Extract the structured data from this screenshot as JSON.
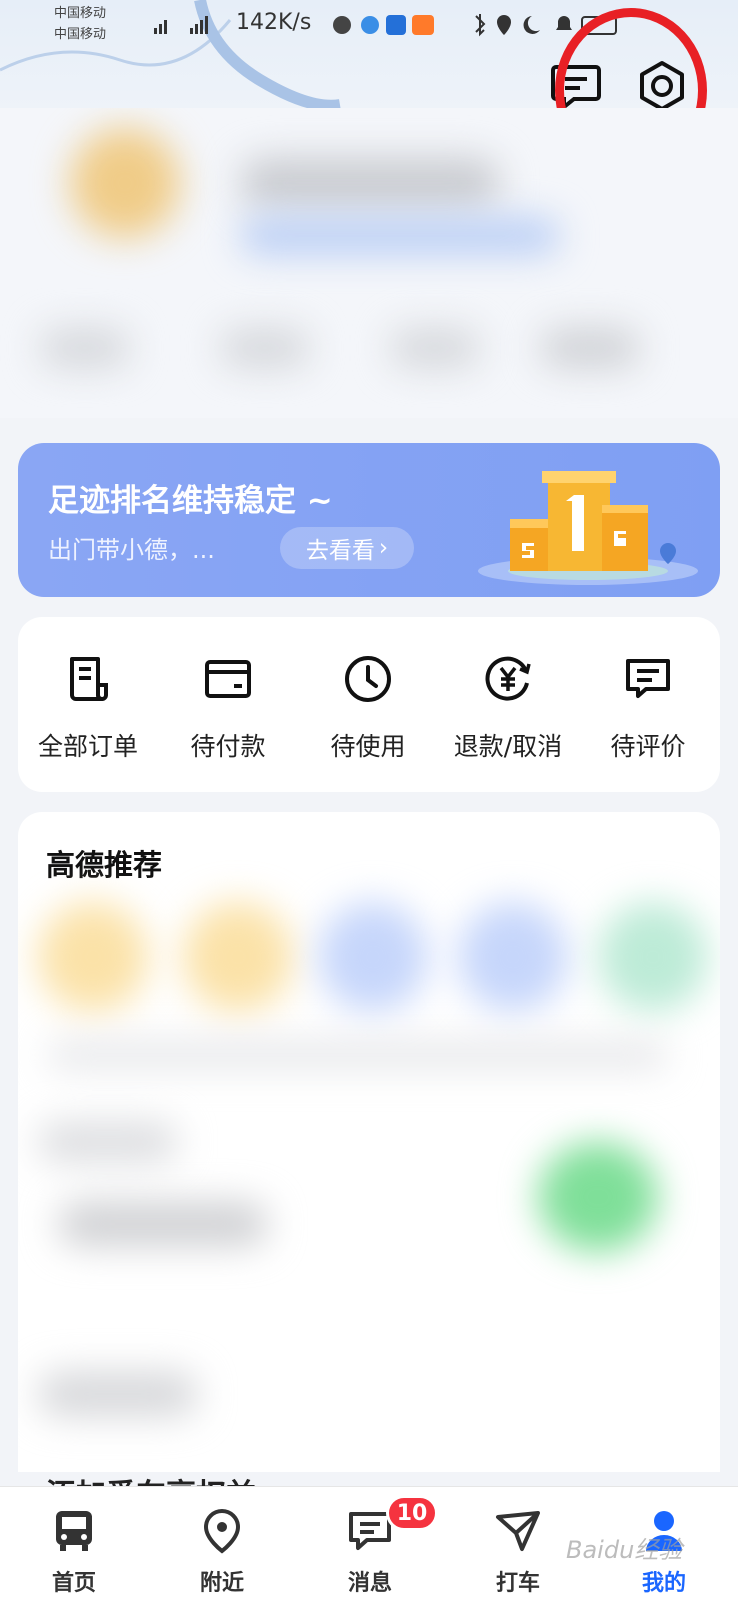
{
  "status_bar": {
    "carrier_1": "中国移动",
    "carrier_2": "中国移动",
    "net_speed": "142K/s"
  },
  "banner": {
    "title": "足迹排名维持稳定 ~",
    "subtitle": "出门带小德，...",
    "button_label": "去看看",
    "button_chevron": "›"
  },
  "orders": [
    {
      "label": "全部订单",
      "icon": "document-list-icon"
    },
    {
      "label": "待付款",
      "icon": "wallet-card-icon"
    },
    {
      "label": "待使用",
      "icon": "clock-icon"
    },
    {
      "label": "退款/取消",
      "icon": "yuan-refund-icon"
    },
    {
      "label": "待评价",
      "icon": "comment-icon"
    }
  ],
  "recommend": {
    "title": "高德推荐",
    "partial_text": "添加爱车享权益"
  },
  "nav": [
    {
      "label": "首页",
      "icon": "bus-icon"
    },
    {
      "label": "附近",
      "icon": "location-pin-icon"
    },
    {
      "label": "消息",
      "icon": "message-icon",
      "badge": "10"
    },
    {
      "label": "打车",
      "icon": "taxi-arrow-icon"
    },
    {
      "label": "我的",
      "icon": "user-icon",
      "active": true
    }
  ],
  "watermark": "Baidu经验",
  "colors": {
    "accent": "#1a66ff",
    "banner": "#8aa6f4",
    "badge": "#f5333f",
    "highlight_circle": "#e82025"
  }
}
